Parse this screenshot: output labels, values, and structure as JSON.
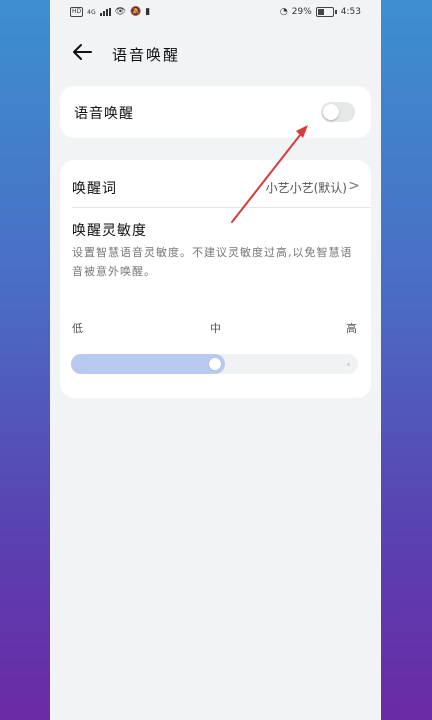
{
  "status_bar": {
    "battery": "29%",
    "time": "4:53",
    "hd": "HD",
    "net": "4G"
  },
  "header": {
    "title": "语音唤醒"
  },
  "toggle_card": {
    "label": "语音唤醒",
    "enabled": false
  },
  "wake_word": {
    "label": "唤醒词",
    "value": "小艺小艺(默认)"
  },
  "sensitivity": {
    "title": "唤醒灵敏度",
    "description": "设置智慧语音灵敏度。不建议灵敏度过高,以免智慧语音被意外唤醒。",
    "low": "低",
    "mid": "中",
    "high": "高",
    "level": 0.5
  },
  "colors": {
    "accent": "#b9c8ef",
    "annotation_arrow": "#d93a3a"
  }
}
